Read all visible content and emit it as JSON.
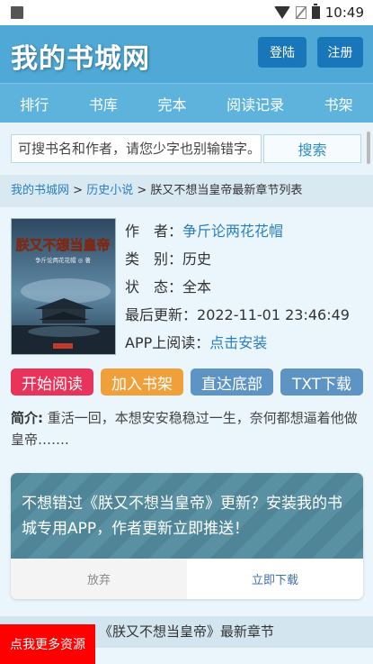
{
  "status_bar": {
    "time": "10:49"
  },
  "header": {
    "site_title": "我的书城网",
    "login_label": "登陆",
    "register_label": "注册"
  },
  "nav": {
    "items": [
      "排行",
      "书库",
      "完本",
      "阅读记录",
      "书架"
    ]
  },
  "search": {
    "placeholder": "可搜书名和作者，请您少字也别输错字。",
    "button_label": "搜索"
  },
  "breadcrumb": {
    "home": "我的书城网",
    "sep1": " > ",
    "category": "历史小说",
    "sep2": " > ",
    "current": "朕又不想当皇帝最新章节列表"
  },
  "book": {
    "cover_title": "朕又不想当皇帝",
    "cover_author": "争斤论两花花帽 ◎ 著",
    "author_label": "作　者：",
    "author": "争斤论两花花帽",
    "category_label": "类　别：",
    "category": "历史",
    "status_label": "状　态：",
    "status": "全本",
    "updated_label": "最后更新：",
    "updated": "2022-11-01 23:46:49",
    "app_label": "APP上阅读：",
    "app_link": "点击安装"
  },
  "actions": {
    "start_reading": "开始阅读",
    "add_shelf": "加入书架",
    "go_bottom": "直达底部",
    "txt_download": "TXT下载"
  },
  "intro": {
    "label": "简介:",
    "text": " 重活一回，本想安安稳稳过一生，奈何都想逼着他做皇帝……."
  },
  "promo": {
    "text": "不想错过《朕又不想当皇帝》更新？安装我的书城专用APP，作者更新立即推送！",
    "cancel_label": "放弃",
    "download_label": "立即下载"
  },
  "latest": {
    "title": "《朕又不想当皇帝》最新章节"
  },
  "float_button": {
    "label": "点我更多资源"
  },
  "colors": {
    "header": "#4fa8d5",
    "nav": "#5db3dc",
    "accent_red": "#e8335a",
    "accent_orange": "#f0a03a",
    "accent_blue": "#5e94c3"
  }
}
